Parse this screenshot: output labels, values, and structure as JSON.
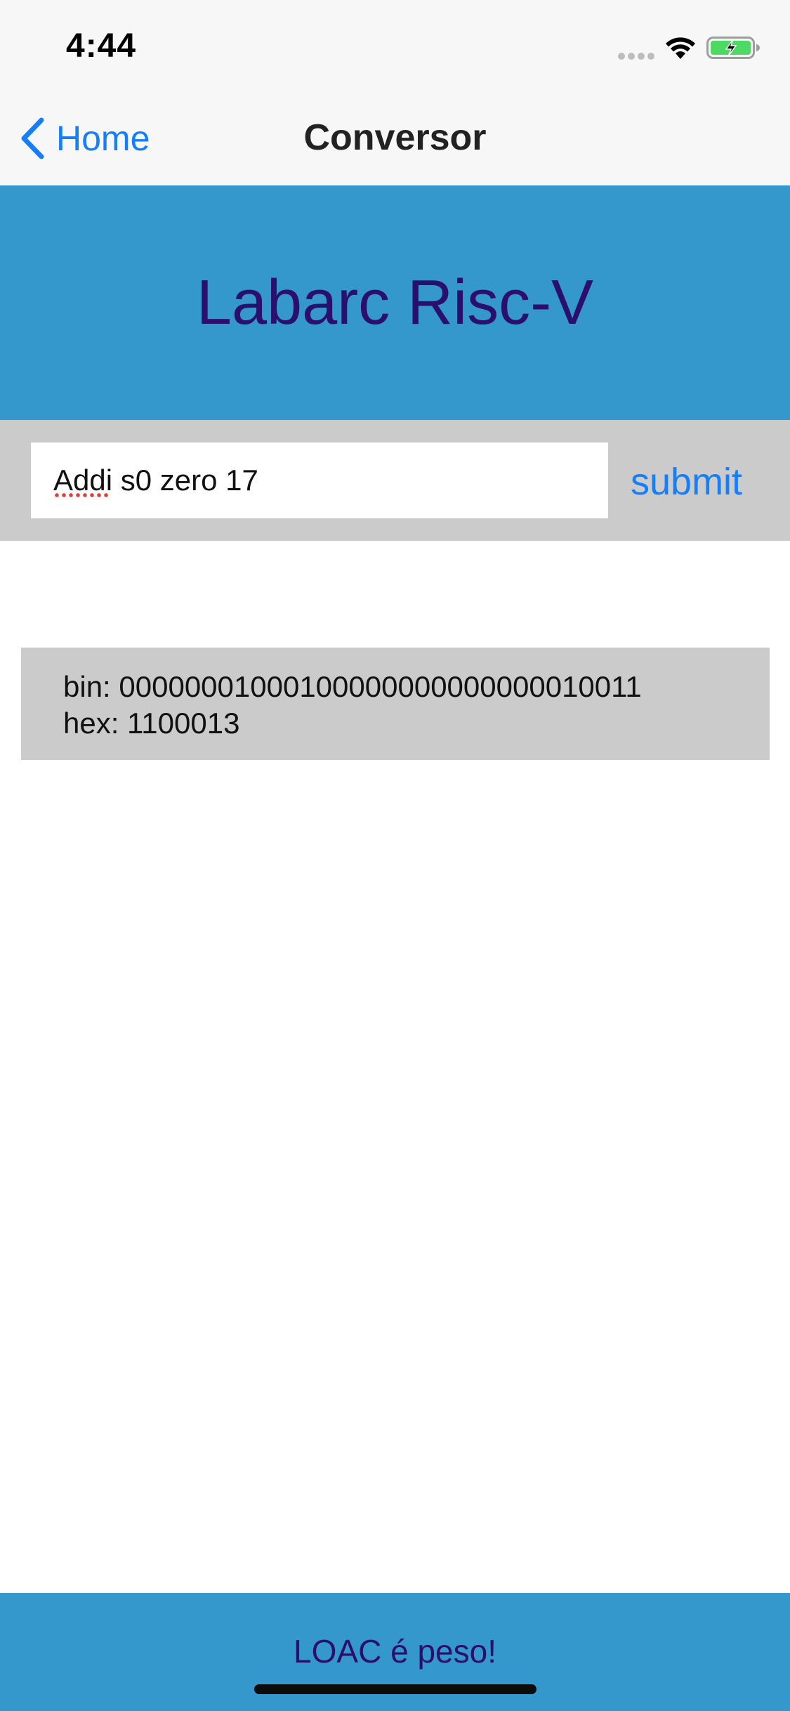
{
  "status_bar": {
    "time": "4:44",
    "icons": [
      "signal-dots-icon",
      "wifi-icon",
      "battery-charging-icon"
    ]
  },
  "nav": {
    "back_label": "Home",
    "back_icon": "chevron-left-icon",
    "title": "Conversor"
  },
  "header": {
    "title": "Labarc Risc-V"
  },
  "form": {
    "input_value": "Addi s0 zero 17",
    "submit_label": "submit"
  },
  "result": {
    "bin_line": "bin: 00000001000100000000000000010011",
    "hex_line": "hex: 1100013"
  },
  "footer": {
    "text": "LOAC é peso!"
  },
  "colors": {
    "accent": "#147efb",
    "banner": "#3498cd",
    "title_text": "#2b0f6e",
    "panel_gray": "#cbcbcb",
    "battery_green": "#4cd964"
  }
}
